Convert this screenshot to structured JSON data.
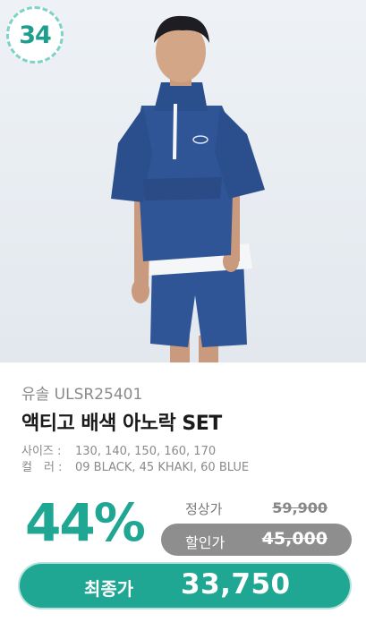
{
  "badge": {
    "rank": "34"
  },
  "product": {
    "brand_code": "유솔 ULSR25401",
    "name": "액티고 배색 아노락 SET",
    "sizes_label": "사이즈 : ",
    "sizes_value": "130, 140, 150, 160, 170",
    "colors_label": "컬　러 : ",
    "colors_value": "09 BLACK, 45 KHAKI, 60 BLUE"
  },
  "pricing": {
    "discount": "44%",
    "regular_label": "정상가",
    "regular_price": "59,900",
    "sale_label": "할인가",
    "sale_price": "45,000",
    "final_label": "최종가",
    "final_price": "33,750"
  },
  "colors": {
    "accent": "#1fa793",
    "jacket": "#2f5597",
    "badge_border": "#7fd3c6"
  }
}
